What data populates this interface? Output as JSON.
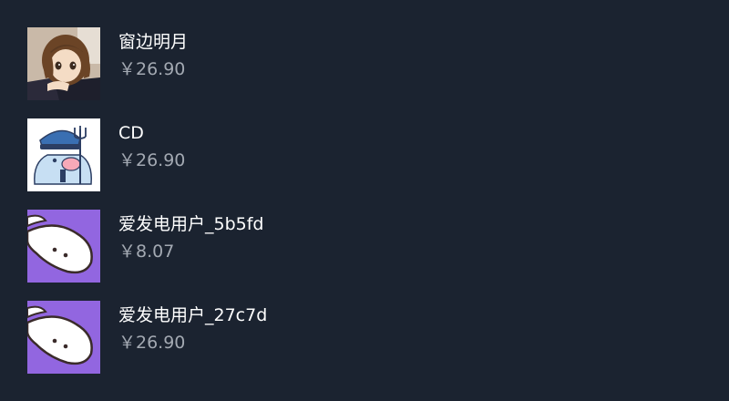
{
  "supporters": [
    {
      "name": "窗边明月",
      "price": "￥26.90",
      "avatar_icon": "anime-girl-avatar-icon"
    },
    {
      "name": "CD",
      "price": "￥26.90",
      "avatar_icon": "security-guard-character-avatar-icon"
    },
    {
      "name": "爱发电用户_5b5fd",
      "price": "￥8.07",
      "avatar_icon": "default-ghost-avatar-icon"
    },
    {
      "name": "爱发电用户_27c7d",
      "price": "￥26.90",
      "avatar_icon": "default-ghost-avatar-icon"
    }
  ],
  "colors": {
    "background": "#1b2330",
    "name_text": "#ffffff",
    "price_text": "#a3a9b2",
    "default_avatar_bg": "#9266e0"
  }
}
